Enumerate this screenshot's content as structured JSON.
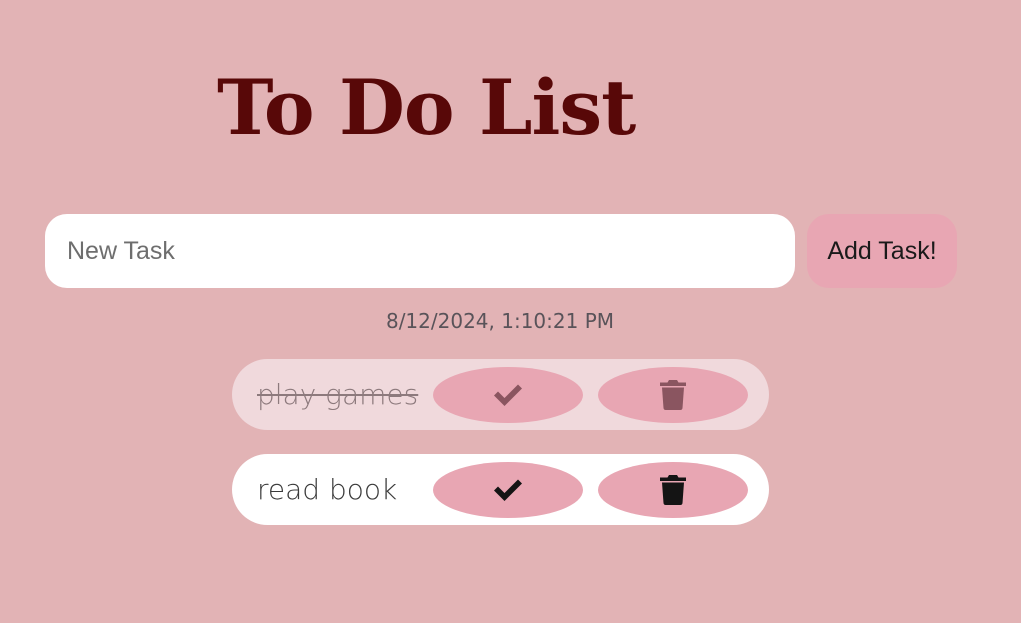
{
  "header": {
    "title": "To Do List"
  },
  "new_task": {
    "value": "",
    "placeholder": "New Task",
    "add_label": "Add Task!"
  },
  "timestamp": "8/12/2024, 1:10:21 PM",
  "tasks": [
    {
      "label": "play games",
      "completed": true,
      "complete_icon": "check-icon",
      "delete_icon": "trash-icon"
    },
    {
      "label": "read book",
      "completed": false,
      "complete_icon": "check-icon",
      "delete_icon": "trash-icon"
    }
  ],
  "colors": {
    "background": "#e2b3b5",
    "title": "#580808",
    "accent": "#e8a6b3",
    "completed_row": "#f0d9dc"
  }
}
